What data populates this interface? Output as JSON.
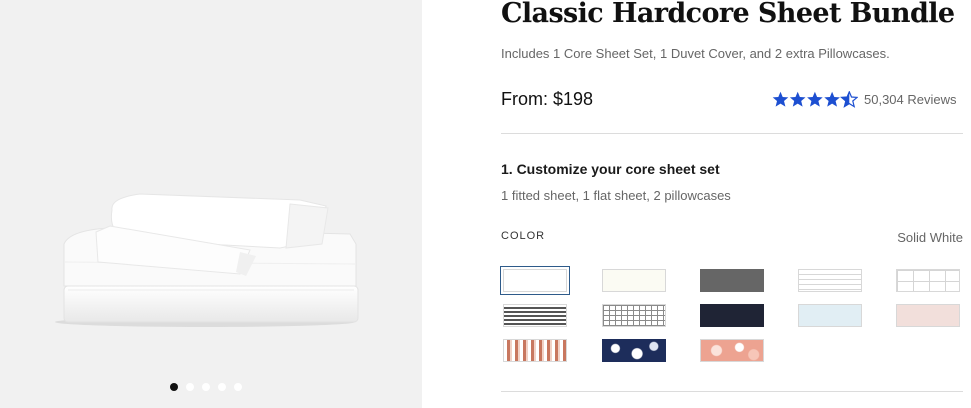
{
  "product": {
    "title": "Classic Hardcore Sheet Bundle",
    "subtitle": "Includes 1 Core Sheet Set, 1 Duvet Cover, and 2 extra Pillowcases.",
    "price": "From: $198",
    "rating": 4.5,
    "reviews": "50,304 Reviews"
  },
  "gallery": {
    "image_icon": "folded-white-sheets-image",
    "slide_count": 5,
    "active_slide": 1
  },
  "customize": {
    "step_title": "1. Customize your core sheet set",
    "step_desc": "1 fitted sheet, 1 flat sheet, 2 pillowcases",
    "color_label": "COLOR",
    "selected_color": "Solid White",
    "swatches": [
      {
        "id": "solid-white",
        "pattern": "solid",
        "color": "#ffffff"
      },
      {
        "id": "cream",
        "pattern": "solid",
        "color": "#fbfbf3"
      },
      {
        "id": "graphite",
        "pattern": "solid",
        "color": "#666666"
      },
      {
        "id": "white-stripe",
        "pattern": "h-stripes",
        "color": "#ffffff"
      },
      {
        "id": "white-grid",
        "pattern": "grid",
        "color": "#ffffff"
      },
      {
        "id": "black-stripe",
        "pattern": "h-stripes-dark",
        "color": "#555555"
      },
      {
        "id": "black-windowpane",
        "pattern": "fine-grid",
        "color": "#ffffff"
      },
      {
        "id": "navy",
        "pattern": "solid",
        "color": "#1f2435"
      },
      {
        "id": "light-blue",
        "pattern": "solid",
        "color": "#e1eef4"
      },
      {
        "id": "blush",
        "pattern": "solid",
        "color": "#f2dfdb"
      },
      {
        "id": "rust-brushstroke",
        "pattern": "brush",
        "color": "#c8775f"
      },
      {
        "id": "navy-floral",
        "pattern": "floral-navy",
        "color": "#1d2d5b"
      },
      {
        "id": "peach-floral",
        "pattern": "floral-peach",
        "color": "#eda391"
      }
    ]
  }
}
